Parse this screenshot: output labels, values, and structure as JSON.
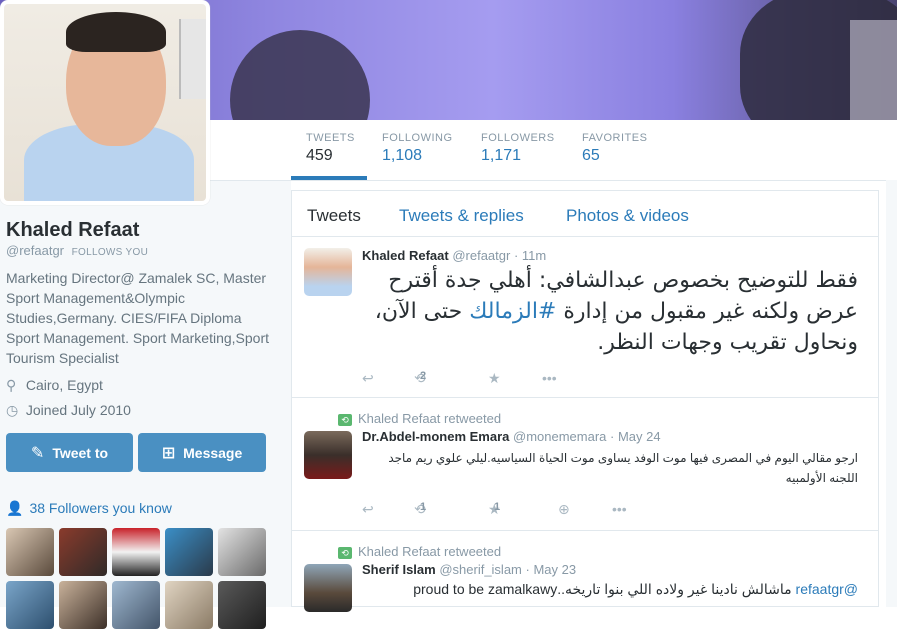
{
  "colors": {
    "accent": "#2b7bb9",
    "retweet_green": "#5ab76f",
    "button_blue": "#4a90c2"
  },
  "stats": [
    {
      "label": "TWEETS",
      "value": "459"
    },
    {
      "label": "FOLLOWING",
      "value": "1,108"
    },
    {
      "label": "FOLLOWERS",
      "value": "1,171"
    },
    {
      "label": "FAVORITES",
      "value": "65"
    }
  ],
  "profile": {
    "name": "Khaled Refaat",
    "handle": "@refaatgr",
    "follows_you": "FOLLOWS YOU",
    "bio": "Marketing Director@ Zamalek SC, Master Sport Management&Olympic Studies,Germany. CIES/FIFA Diploma Sport Management. Sport Marketing,Sport Tourism Specialist",
    "location": "Cairo, Egypt",
    "joined": "Joined July 2010",
    "location_icon": "map-pin-icon",
    "calendar_icon": "clock-icon"
  },
  "buttons": {
    "tweet_to": "Tweet to",
    "message": "Message"
  },
  "followers_you_know": "38 Followers you know",
  "tabs": [
    "Tweets",
    "Tweets & replies",
    "Photos & videos"
  ],
  "tweets": [
    {
      "name": "Khaled Refaat",
      "handle": "@refaatgr",
      "time": "· 11m",
      "text_before": "فقط للتوضيح بخصوص عبدالشافي: أهلي جدة أقترح عرض ولكنه غير مقبول من إدارة ",
      "hashtag": "#الزمالك",
      "text_after": " حتى الآن، ونحاول تقريب وجهات النظر.",
      "retweets": "2"
    },
    {
      "retweeted_by": "Khaled Refaat retweeted",
      "name": "Dr.Abdel-monem Emara",
      "handle": "@monememara",
      "time": "· May 24",
      "text": "ارجو مقالي اليوم في المصرى فيها موت الوفد يساوى موت الحياة السياسيه.ليلي علوي ريم ماجد اللجنه الأولمبيه",
      "retweets": "1",
      "favorites": "1"
    },
    {
      "retweeted_by": "Khaled Refaat retweeted",
      "name": "Sherif Islam",
      "handle": "@sherif_islam",
      "time": "· May 23",
      "mention": "@refaatgr",
      "text": " ماشالش نادينا غير ولاده اللي بنوا تاريخه..proud to be zamalkawy"
    }
  ]
}
